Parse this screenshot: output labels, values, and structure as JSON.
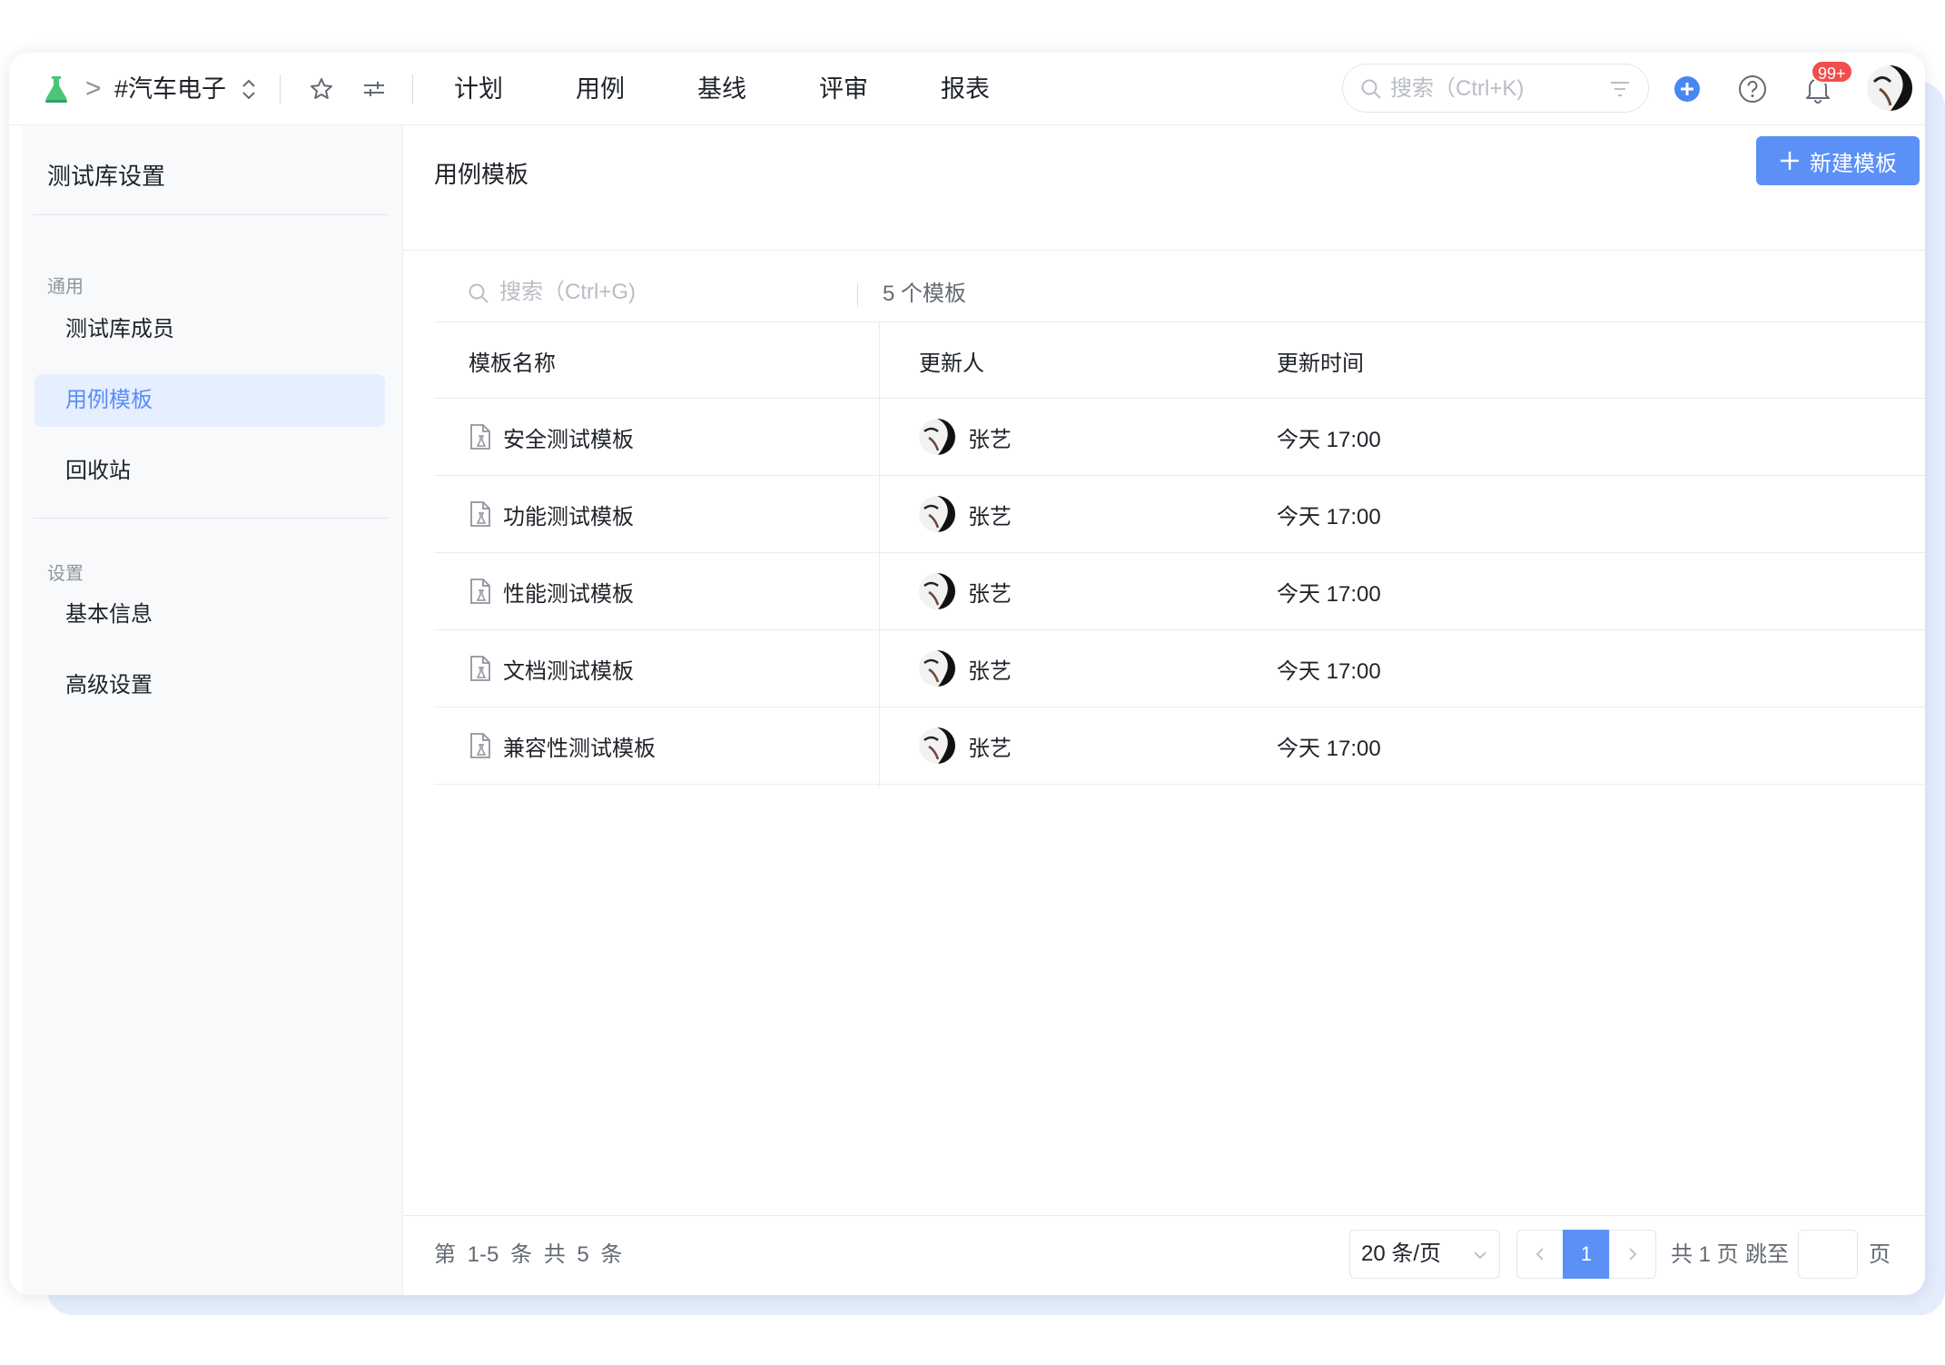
{
  "header": {
    "project_name": "#汽车电子",
    "breadcrumb_separator": ">",
    "nav": [
      "计划",
      "用例",
      "基线",
      "评审",
      "报表"
    ],
    "search_placeholder": "搜索（Ctrl+K)",
    "notification_badge": "99+",
    "colors": {
      "brand": "#4cc47a",
      "add": "#4a86f2",
      "badge": "#f04e4e"
    },
    "icons": [
      "logo-flask-icon",
      "chevron-right-icon",
      "switch-updown-icon",
      "star-icon",
      "settings-sliders-icon",
      "search-icon",
      "filter-icon",
      "add-circle-icon",
      "help-icon",
      "bell-icon"
    ]
  },
  "sidebar": {
    "title": "测试库设置",
    "groups": [
      {
        "label": "通用",
        "items": [
          {
            "label": "测试库成员",
            "active": false
          },
          {
            "label": "用例模板",
            "active": true
          },
          {
            "label": "回收站",
            "active": false
          }
        ]
      },
      {
        "label": "设置",
        "items": [
          {
            "label": "基本信息",
            "active": false
          },
          {
            "label": "高级设置",
            "active": false
          }
        ]
      }
    ]
  },
  "main": {
    "title": "用例模板",
    "new_button": "新建模板",
    "search_placeholder": "搜索（Ctrl+G)",
    "count": "5 个模板",
    "columns": [
      "模板名称",
      "更新人",
      "更新时间"
    ],
    "rows": [
      {
        "name": "安全测试模板",
        "updater": "张艺",
        "time": "今天 17:00"
      },
      {
        "name": "功能测试模板",
        "updater": "张艺",
        "time": "今天 17:00"
      },
      {
        "name": "性能测试模板",
        "updater": "张艺",
        "time": "今天 17:00"
      },
      {
        "name": "文档测试模板",
        "updater": "张艺",
        "time": "今天 17:00"
      },
      {
        "name": "兼容性测试模板",
        "updater": "张艺",
        "time": "今天 17:00"
      }
    ]
  },
  "pagination": {
    "range": "第 1-5 条  共 5 条",
    "page_size": "20 条/页",
    "current_page": "1",
    "total_pages": "共 1 页",
    "jump_label": "跳至",
    "page_unit": "页"
  }
}
